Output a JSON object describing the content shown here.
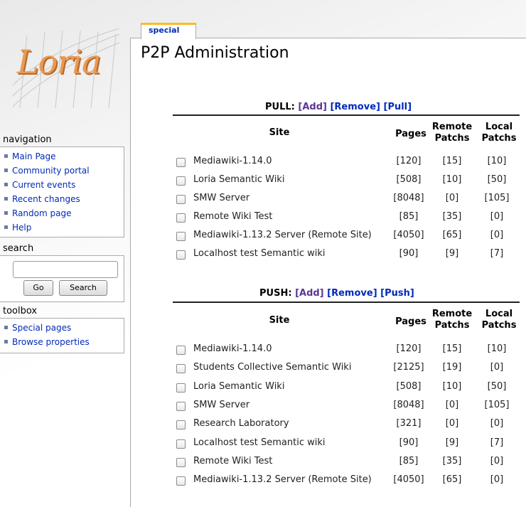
{
  "logo": {
    "text": "Loria"
  },
  "tab": {
    "label": "special"
  },
  "page_title": "P2P Administration",
  "navigation": {
    "title": "navigation",
    "items": [
      "Main Page",
      "Community portal",
      "Current events",
      "Recent changes",
      "Random page",
      "Help"
    ]
  },
  "search": {
    "title": "search",
    "value": "",
    "go_label": "Go",
    "search_label": "Search"
  },
  "toolbox": {
    "title": "toolbox",
    "items": [
      "Special pages",
      "Browse properties"
    ]
  },
  "columns": {
    "site": "Site",
    "pages": "Pages",
    "remote_line1": "Remote",
    "remote_line2": "Patchs",
    "local_line1": "Local",
    "local_line2": "Patchs"
  },
  "pull": {
    "label": "PULL:",
    "add": "[Add]",
    "remove": "[Remove]",
    "action": "[Pull]",
    "rows": [
      {
        "site": "Mediawiki-1.14.0",
        "pages": "[120]",
        "remote": "[15]",
        "local": "[10]"
      },
      {
        "site": "Loria Semantic Wiki",
        "pages": "[508]",
        "remote": "[10]",
        "local": "[50]"
      },
      {
        "site": "SMW Server",
        "pages": "[8048]",
        "remote": "[0]",
        "local": "[105]"
      },
      {
        "site": "Remote Wiki Test",
        "pages": "[85]",
        "remote": "[35]",
        "local": "[0]"
      },
      {
        "site": "Mediawiki-1.13.2 Server (Remote Site)",
        "pages": "[4050]",
        "remote": "[65]",
        "local": "[0]"
      },
      {
        "site": "Localhost test Semantic wiki",
        "pages": "[90]",
        "remote": "[9]",
        "local": "[7]"
      }
    ]
  },
  "push": {
    "label": "PUSH:",
    "add": "[Add]",
    "remove": "[Remove]",
    "action": "[Push]",
    "rows": [
      {
        "site": "Mediawiki-1.14.0",
        "pages": "[120]",
        "remote": "[15]",
        "local": "[10]"
      },
      {
        "site": "Students Collective Semantic Wiki",
        "pages": "[2125]",
        "remote": "[19]",
        "local": "[0]"
      },
      {
        "site": "Loria Semantic Wiki",
        "pages": "[508]",
        "remote": "[10]",
        "local": "[50]"
      },
      {
        "site": "SMW Server",
        "pages": "[8048]",
        "remote": "[0]",
        "local": "[105]"
      },
      {
        "site": "Research Laboratory",
        "pages": "[321]",
        "remote": "[0]",
        "local": "[0]"
      },
      {
        "site": "Localhost test Semantic wiki",
        "pages": "[90]",
        "remote": "[9]",
        "local": "[7]"
      },
      {
        "site": "Remote Wiki Test",
        "pages": "[85]",
        "remote": "[35]",
        "local": "[0]"
      },
      {
        "site": "Mediawiki-1.13.2 Server (Remote Site)",
        "pages": "[4050]",
        "remote": "[65]",
        "local": "[0]"
      }
    ]
  }
}
